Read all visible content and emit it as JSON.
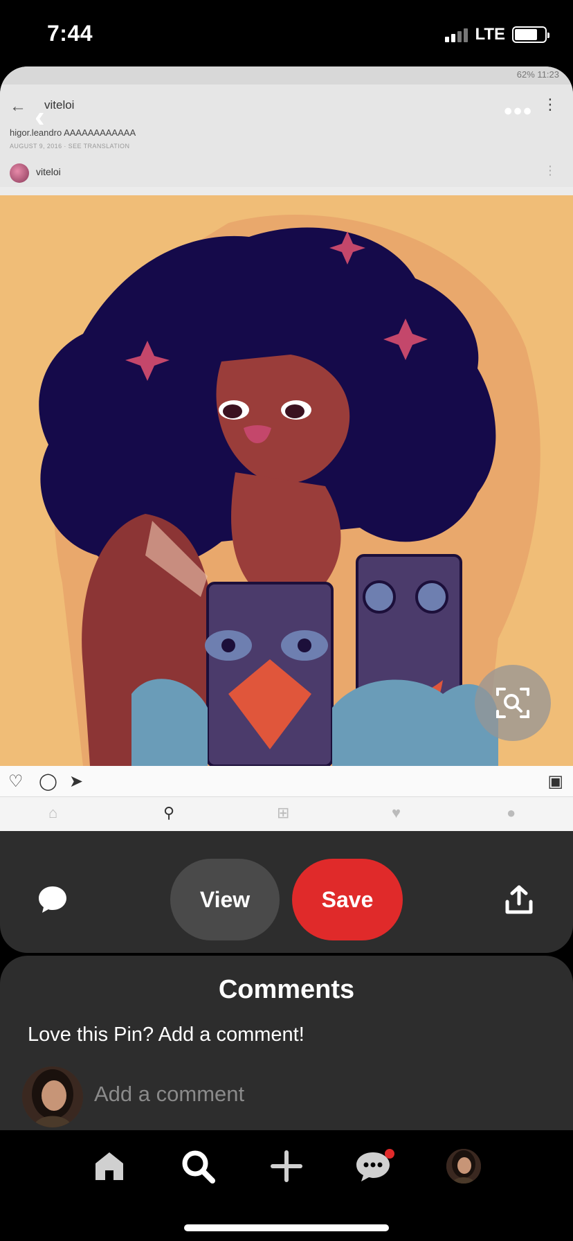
{
  "status_bar": {
    "time": "7:44",
    "network": "LTE"
  },
  "pin_image": {
    "screenshot_status_right": "62% 11:23",
    "screenshot_username": "viteloi",
    "screenshot_comment": "higor.leandro AAAAAAAAAAAA",
    "screenshot_date": "AUGUST 9, 2016 · SEE TRANSLATION",
    "screenshot_poster": "viteloi"
  },
  "actions": {
    "view_label": "View",
    "save_label": "Save"
  },
  "comments": {
    "title": "Comments",
    "prompt": "Love this Pin? Add a comment!",
    "input_placeholder": "Add a comment"
  },
  "colors": {
    "save": "#e02a2a",
    "panel": "#2d2d2d",
    "notification": "#e02a2a"
  },
  "icons": {
    "back": "chevron-left-icon",
    "more": "more-dots-icon",
    "lens": "visual-search-icon",
    "comment": "speech-bubble-icon",
    "share": "share-icon",
    "nav": [
      "home-icon",
      "search-icon",
      "plus-icon",
      "messages-icon",
      "profile-avatar"
    ]
  }
}
